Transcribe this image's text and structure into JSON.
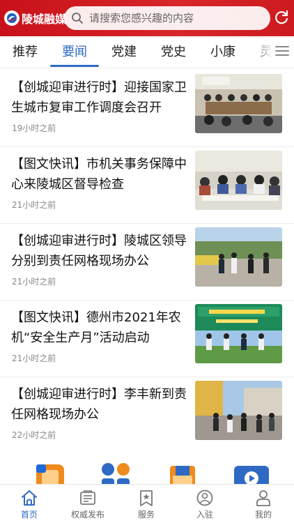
{
  "header": {
    "logo_text": "陵城融媒",
    "search_placeholder": "请搜索您感兴趣的内容",
    "brand_color": "#d2201f"
  },
  "tabs": [
    {
      "label": "推荐",
      "active": false
    },
    {
      "label": "要闻",
      "active": true
    },
    {
      "label": "党建",
      "active": false
    },
    {
      "label": "党史",
      "active": false
    },
    {
      "label": "小康",
      "active": false
    },
    {
      "label": "灵",
      "active": false
    }
  ],
  "news": [
    {
      "title": "【创城迎审进行时】迎接国家卫生城市复审工作调度会召开",
      "time": "19小时之前",
      "thumb": "meeting-room-photo"
    },
    {
      "title": "【图文快讯】市机关事务保障中心来陵城区督导检查",
      "time": "21小时之前",
      "thumb": "conference-photo"
    },
    {
      "title": "【创城迎审进行时】陵城区领导分别到责任网格现场办公",
      "time": "21小时之前",
      "thumb": "street-inspection-photo"
    },
    {
      "title": "【图文快讯】德州市2021年农机“安全生产月”活动启动",
      "time": "21小时之前",
      "thumb": "stage-event-photo"
    },
    {
      "title": "【创城迎审进行时】李丰新到责任网格现场办公",
      "time": "22小时之前",
      "thumb": "outdoor-site-photo"
    }
  ],
  "bottom_nav": [
    {
      "label": "首页",
      "icon": "home-icon",
      "active": true
    },
    {
      "label": "权威发布",
      "icon": "newspaper-icon",
      "active": false
    },
    {
      "label": "服务",
      "icon": "bookmark-star-icon",
      "active": false
    },
    {
      "label": "入驻",
      "icon": "user-circle-icon",
      "active": false
    },
    {
      "label": "我的",
      "icon": "person-icon",
      "active": false
    }
  ],
  "colors": {
    "accent": "#2e6ac4",
    "header_red": "#d2201f",
    "time_gray": "#888888"
  }
}
